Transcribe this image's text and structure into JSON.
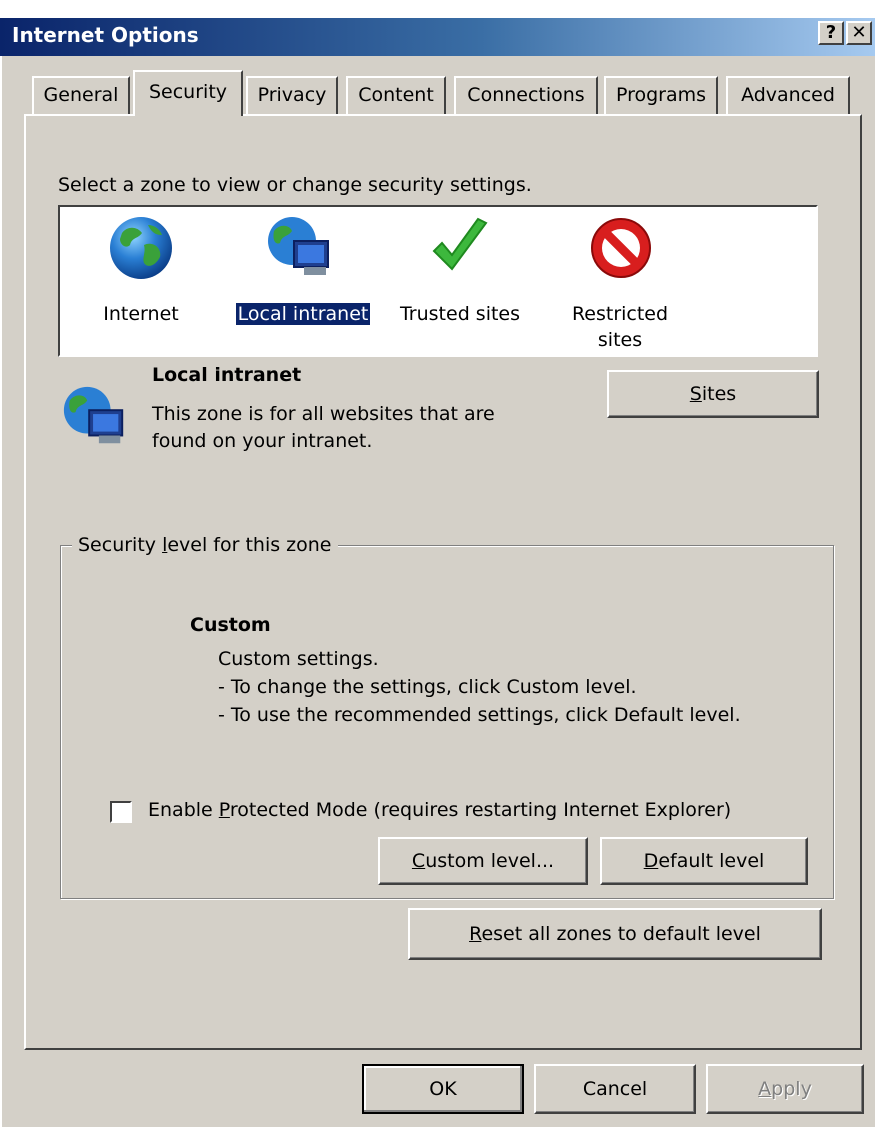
{
  "window": {
    "title": "Internet Options",
    "help_btn": "?",
    "close_btn": "✕"
  },
  "tabs": [
    {
      "label": "General"
    },
    {
      "label": "Security"
    },
    {
      "label": "Privacy"
    },
    {
      "label": "Content"
    },
    {
      "label": "Connections"
    },
    {
      "label": "Programs"
    },
    {
      "label": "Advanced"
    }
  ],
  "zones": {
    "prompt": "Select a zone to view or change security settings.",
    "items": [
      {
        "label": "Internet",
        "icon": "globe-icon"
      },
      {
        "label": "Local intranet",
        "icon": "intranet-icon",
        "selected": true
      },
      {
        "label": "Trusted sites",
        "icon": "checkmark-icon"
      },
      {
        "label_line1": "Restricted",
        "label_line2": "sites",
        "icon": "restricted-icon"
      }
    ]
  },
  "zone_info": {
    "name": "Local intranet",
    "desc_line1": "This zone is for all websites that are",
    "desc_line2": "found on your intranet.",
    "sites_button": {
      "prefix": "",
      "accel": "S",
      "rest": "ites"
    }
  },
  "security_level": {
    "group_label": {
      "prefix": "Security ",
      "accel": "l",
      "rest": "evel for this zone"
    },
    "level_name": "Custom",
    "line1": "Custom settings.",
    "line2": "- To change the settings, click Custom level.",
    "line3": "- To use the recommended settings, click Default level."
  },
  "protected_mode": {
    "checked": false,
    "label": {
      "prefix": "Enable ",
      "accel": "P",
      "rest": "rotected Mode (requires restarting Internet Explorer)"
    }
  },
  "buttons": {
    "custom_level": {
      "prefix": "",
      "accel": "C",
      "rest": "ustom level..."
    },
    "default_level": {
      "prefix": "",
      "accel": "D",
      "rest": "efault level"
    },
    "reset_all": {
      "prefix": "",
      "accel": "R",
      "rest": "eset all zones to default level"
    },
    "ok": "OK",
    "cancel": "Cancel",
    "apply": {
      "prefix": "",
      "accel": "A",
      "rest": "pply"
    }
  },
  "colors": {
    "face": "#d4d0c8",
    "title_start": "#0a246a",
    "title_end": "#a6caf0",
    "selection": "#0a246a"
  }
}
